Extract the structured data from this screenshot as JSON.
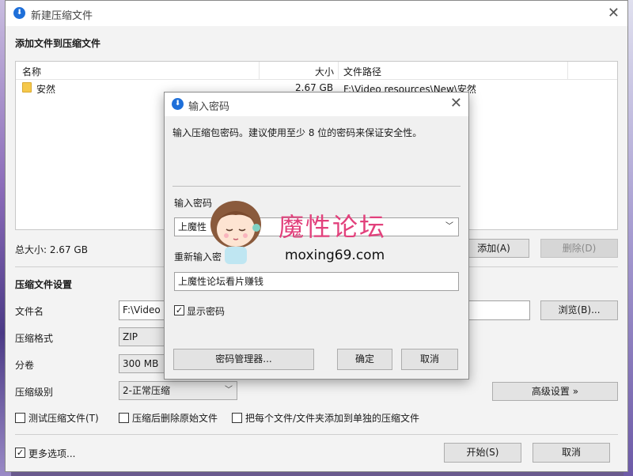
{
  "main_window": {
    "title": "新建压缩文件",
    "add_section_title": "添加文件到压缩文件",
    "file_list": {
      "columns": [
        "名称",
        "大小",
        "文件路径"
      ],
      "rows": [
        {
          "name": "安然",
          "size": "2.67 GB",
          "path": "F:\\Video resources\\New\\安然"
        }
      ]
    },
    "total_size": "总大小: 2.67 GB",
    "add_button": "添加(A)",
    "delete_button": "删除(D)",
    "settings_title": "压缩文件设置",
    "filename_label": "文件名",
    "filename_value": "F:\\Video",
    "browse_button": "浏览(B)...",
    "format_label": "压缩格式",
    "format_value": "ZIP",
    "split_label": "分卷",
    "split_value": "300 MB",
    "level_label": "压缩级别",
    "level_value": "2-正常压缩",
    "advanced_button": "高级设置 »",
    "checkboxes": {
      "test": "测试压缩文件(T)",
      "delete_after": "压缩后删除原始文件",
      "separate": "把每个文件/文件夹添加到单独的压缩文件",
      "more_options": "更多选项..."
    },
    "start_button": "开始(S)",
    "cancel_button": "取消"
  },
  "password_dialog": {
    "title": "输入密码",
    "description": "输入压缩包密码。建议使用至少 8 位的密码来保证安全性。",
    "enter_label": "输入密码",
    "enter_value": "上魔性",
    "reenter_label": "重新输入密",
    "reenter_value": "上魔性论坛看片赚钱",
    "show_password_label": "显示密码",
    "manager_button": "密码管理器...",
    "ok_button": "确定",
    "cancel_button": "取消"
  },
  "watermark": {
    "title": "魔性论坛",
    "url": "moxing69.com"
  },
  "colors": {
    "accent": "#1e6fd9",
    "watermark_pink": "#e2417c"
  }
}
